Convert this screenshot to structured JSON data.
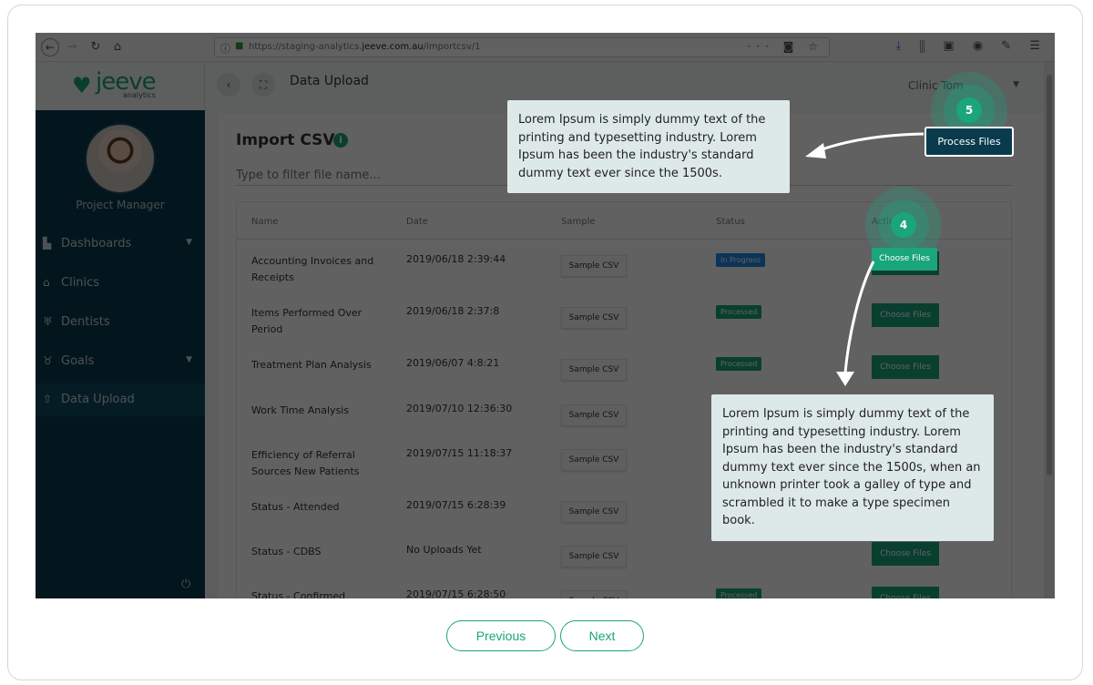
{
  "browser": {
    "url_prefix": "https://staging-analytics.",
    "url_domain": "jeeve.com.au",
    "url_path": "/importcsv/1"
  },
  "app": {
    "logo_text": "jeeve",
    "logo_sub": "analytics",
    "user_role": "Project Manager",
    "page_title": "Data Upload",
    "clinic_select": "Clinic Tom",
    "menu": [
      {
        "label": "Dashboards",
        "icon": "chart-icon"
      },
      {
        "label": "Clinics",
        "icon": "home-icon"
      },
      {
        "label": "Dentists",
        "icon": "tooth-icon"
      },
      {
        "label": "Goals",
        "icon": "trophy-icon"
      },
      {
        "label": "Data Upload",
        "icon": "upload-icon"
      }
    ]
  },
  "import": {
    "title": "Import CSV",
    "filter_placeholder": "Type to filter file name...",
    "columns": [
      "Name",
      "Date",
      "Sample",
      "Status",
      "Action"
    ],
    "sample_label": "Sample CSV",
    "choose_label": "Choose Files",
    "process_label": "Process Files",
    "rows": [
      {
        "name": "Accounting Invoices and Receipts",
        "date": "2019/06/18 2:39:44",
        "status": "In Progress"
      },
      {
        "name": "Items Performed Over Period",
        "date": "2019/06/18 2:37:8",
        "status": "Processed"
      },
      {
        "name": "Treatment Plan Analysis",
        "date": "2019/06/07 4:8:21",
        "status": "Processed"
      },
      {
        "name": "Work Time Analysis",
        "date": "2019/07/10 12:36:30",
        "status": ""
      },
      {
        "name": "Efficiency of Referral Sources New Patients",
        "date": "2019/07/15 11:18:37",
        "status": ""
      },
      {
        "name": "Status - Attended",
        "date": "2019/07/15 6:28:39",
        "status": ""
      },
      {
        "name": "Status - CDBS",
        "date": "No Uploads Yet",
        "status": ""
      },
      {
        "name": "Status - Confirmed",
        "date": "2019/07/15 6:28:50",
        "status": "Processed"
      }
    ]
  },
  "tour": {
    "step5_number": "5",
    "step4_number": "4",
    "tooltip_top": "Lorem Ipsum is simply dummy text of the printing and typesetting industry. Lorem Ipsum has been the industry's standard dummy text ever since the 1500s.",
    "tooltip_bottom": "Lorem Ipsum is simply dummy text of the printing and typesetting industry. Lorem Ipsum has been the industry's standard dummy text ever since the 1500s, when an unknown printer took a galley of type and scrambled it to make a type specimen book.",
    "prev_label": "Previous",
    "next_label": "Next"
  },
  "colors": {
    "accent": "#1aa57a",
    "sidebar": "#0a3b4d",
    "tooltip": "#dde9e8"
  }
}
